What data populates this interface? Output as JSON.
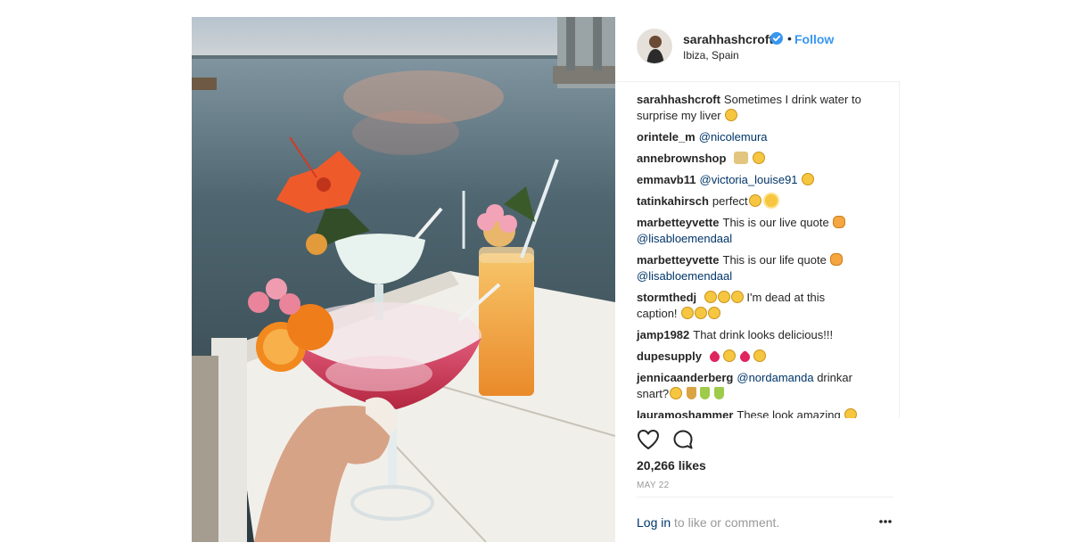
{
  "post": {
    "image_alt": "Cocktails on a table by the sea"
  },
  "header": {
    "username": "sarahhashcroft",
    "separator": "•",
    "follow_label": "Follow",
    "location": "Ibiza, Spain"
  },
  "comments": [
    {
      "user": "sarahhashcroft",
      "text": "Sometimes I drink water to surprise my liver",
      "emojis": [
        "wink-face"
      ]
    },
    {
      "user": "orintele_m",
      "mention": "@nicolemura"
    },
    {
      "user": "annebrownshop",
      "emojis": [
        "clinking-glasses",
        "smiling-face"
      ]
    },
    {
      "user": "emmavb11",
      "mention": "@victoria_louise91",
      "emojis": [
        "rofl-face"
      ]
    },
    {
      "user": "tatinkahirsch",
      "text": "perfect",
      "emojis": [
        "heart-eyes-face",
        "sun"
      ]
    },
    {
      "user": "marbetteyvette",
      "text": "This is our live quote",
      "emojis": [
        "cat-face"
      ],
      "mention_line2": "@lisabloemendaal"
    },
    {
      "user": "marbetteyvette",
      "text": "This is our life quote",
      "emojis": [
        "cat-face"
      ],
      "mention_line2": "@lisabloemendaal"
    },
    {
      "user": "stormthedj",
      "text_a": "I'm dead at this",
      "text_b": "caption!",
      "emojis": [
        "laughing-face",
        "laughing-face",
        "laughing-face",
        "rofl-face",
        "rofl-face",
        "rofl-face"
      ]
    },
    {
      "user": "jamp1982",
      "text": "That drink looks delicious!!!"
    },
    {
      "user": "dupesupply",
      "emojis": [
        "heart",
        "heart-eyes-face",
        "heart",
        "heart-eyes-face"
      ]
    },
    {
      "user": "jennicaanderberg",
      "mention": "@nordamanda",
      "text": "drinkar",
      "text_line2": "snart?",
      "emojis": [
        "heart-eyes-face",
        "tropical-drink",
        "cocktail",
        "cocktail"
      ]
    },
    {
      "user": "lauramoshammer",
      "text": "These look amazing",
      "emojis": [
        "smiling-face"
      ]
    }
  ],
  "actions": {
    "likes": "20,266 likes",
    "date": "MAY 22",
    "login_link": "Log in",
    "login_rest": " to like or comment."
  },
  "colors": {
    "link": "#003569",
    "follow": "#3897f0",
    "verified": "#3897f0",
    "muted": "#999999"
  },
  "icons": [
    "verified-badge-icon",
    "heart-icon",
    "comment-bubble-icon",
    "more-dots-icon"
  ]
}
